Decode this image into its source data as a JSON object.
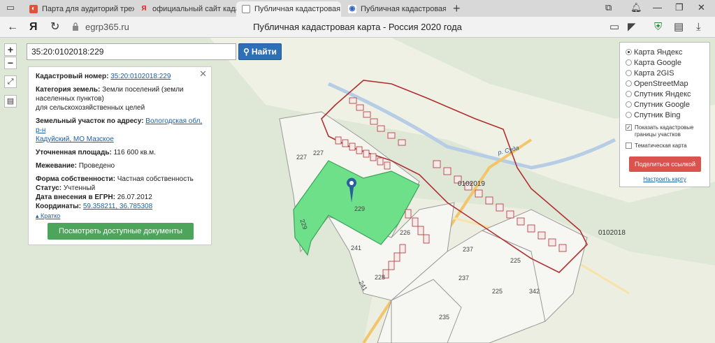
{
  "browser": {
    "tabs": [
      {
        "title": "Парта для аудиторий трех",
        "active": false
      },
      {
        "title": "официальный сайт кадастр",
        "active": false
      },
      {
        "title": "Публичная кадастровая",
        "active": true
      },
      {
        "title": "Публичная кадастровая ка",
        "active": false
      }
    ],
    "new_tab": "+",
    "url": "egrp365.ru",
    "page_title": "Публичная кадастровая карта - Россия 2020 года"
  },
  "search": {
    "value": "35:20:0102018:229",
    "button_label": "Найти"
  },
  "zoom": {
    "in": "+",
    "out": "−"
  },
  "info": {
    "cadastral_label": "Кадастровый номер:",
    "cadastral_value": "35:20:0102018:229",
    "category_label": "Категория земель:",
    "category_value": "Земли поселений (земли населенных пунктов)",
    "category_value2": "для сельскохозяйственных целей",
    "address_label": "Земельный участок по адресу:",
    "address_value": "Вологодская обл, р-н",
    "address_value2": "Кадуйский, МО Мазское",
    "area_label": "Уточненная площадь:",
    "area_value": "116 600 кв.м.",
    "survey_label": "Межевание:",
    "survey_value": "Проведено",
    "ownership_label": "Форма собственности:",
    "ownership_value": "Частная собственность",
    "status_label": "Статус:",
    "status_value": "Учтенный",
    "date_label": "Дата внесения в ЕГРН:",
    "date_value": "26.07.2012",
    "coords_label": "Координаты:",
    "coords_value": "59.358211, 36.785308",
    "collapse_label": "Кратко",
    "docs_button": "Посмотреть доступные документы"
  },
  "layers": {
    "options": [
      {
        "label": "Карта Яндекс",
        "selected": true
      },
      {
        "label": "Карта Google",
        "selected": false
      },
      {
        "label": "Карта 2GIS",
        "selected": false
      },
      {
        "label": "OpenStreetMap",
        "selected": false
      },
      {
        "label": "Спутник Яндекс",
        "selected": false
      },
      {
        "label": "Спутник Google",
        "selected": false
      },
      {
        "label": "Спутник Bing",
        "selected": false
      }
    ],
    "show_borders_label": "Показать кадастровые границы участков",
    "show_borders_checked": true,
    "thematic_label": "Тематическая карта",
    "thematic_checked": false,
    "share_button": "Поделиться ссылкой",
    "configure_link": "Настроить карту"
  },
  "map_labels": {
    "river": "р. Суда",
    "block1": "0102019",
    "block2": "0102018",
    "parcels": [
      "227",
      "227",
      "229",
      "226",
      "241",
      "241",
      "228",
      "237",
      "237",
      "225",
      "225",
      "342",
      "235",
      "229"
    ]
  },
  "colors": {
    "selected_parcel": "#6ee08a",
    "parcel_border": "#b03030",
    "map_bg": "#dfe8d6",
    "find_button": "#2f6fb8",
    "docs_button": "#4ca55a",
    "share_button": "#d9534f"
  }
}
